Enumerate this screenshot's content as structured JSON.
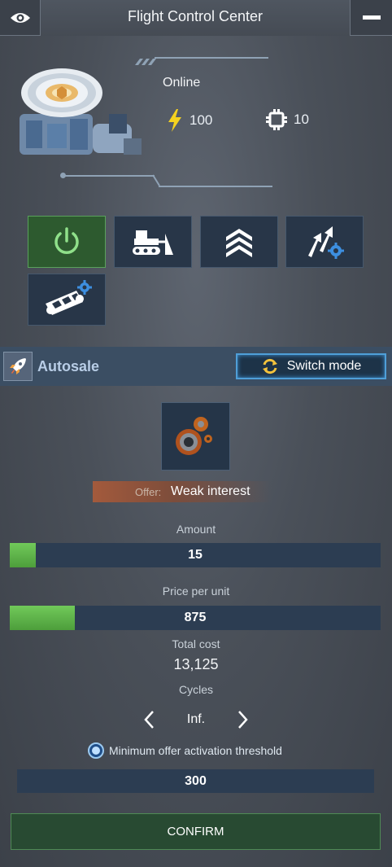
{
  "header": {
    "title": "Flight Control Center"
  },
  "station": {
    "status": "Online",
    "energy": "100",
    "chips": "10"
  },
  "actions": [
    {
      "name": "power",
      "icon": "power-icon"
    },
    {
      "name": "bulldozer",
      "icon": "bulldozer-icon"
    },
    {
      "name": "upgrade",
      "icon": "chevrons-up-icon"
    },
    {
      "name": "trade-settings",
      "icon": "arrows-gear-icon"
    },
    {
      "name": "conveyor-settings",
      "icon": "conveyor-gear-icon"
    }
  ],
  "autosale": {
    "label": "Autosale",
    "switch_label": "Switch mode"
  },
  "offer": {
    "label": "Offer:",
    "value": "Weak interest"
  },
  "amount": {
    "label": "Amount",
    "value": "15",
    "fill_fraction": 0.07
  },
  "price": {
    "label": "Price per unit",
    "value": "875",
    "fill_fraction": 0.175
  },
  "total": {
    "label": "Total cost",
    "value": "13,125"
  },
  "cycles": {
    "label": "Cycles",
    "value": "Inf."
  },
  "threshold": {
    "label": "Minimum offer activation threshold",
    "value": "300",
    "selected": true
  },
  "confirm_label": "CONFIRM",
  "colors": {
    "accent_blue": "#4f9fd8",
    "accent_green": "#5aa05c",
    "offer_orange": "#a35a3c"
  }
}
